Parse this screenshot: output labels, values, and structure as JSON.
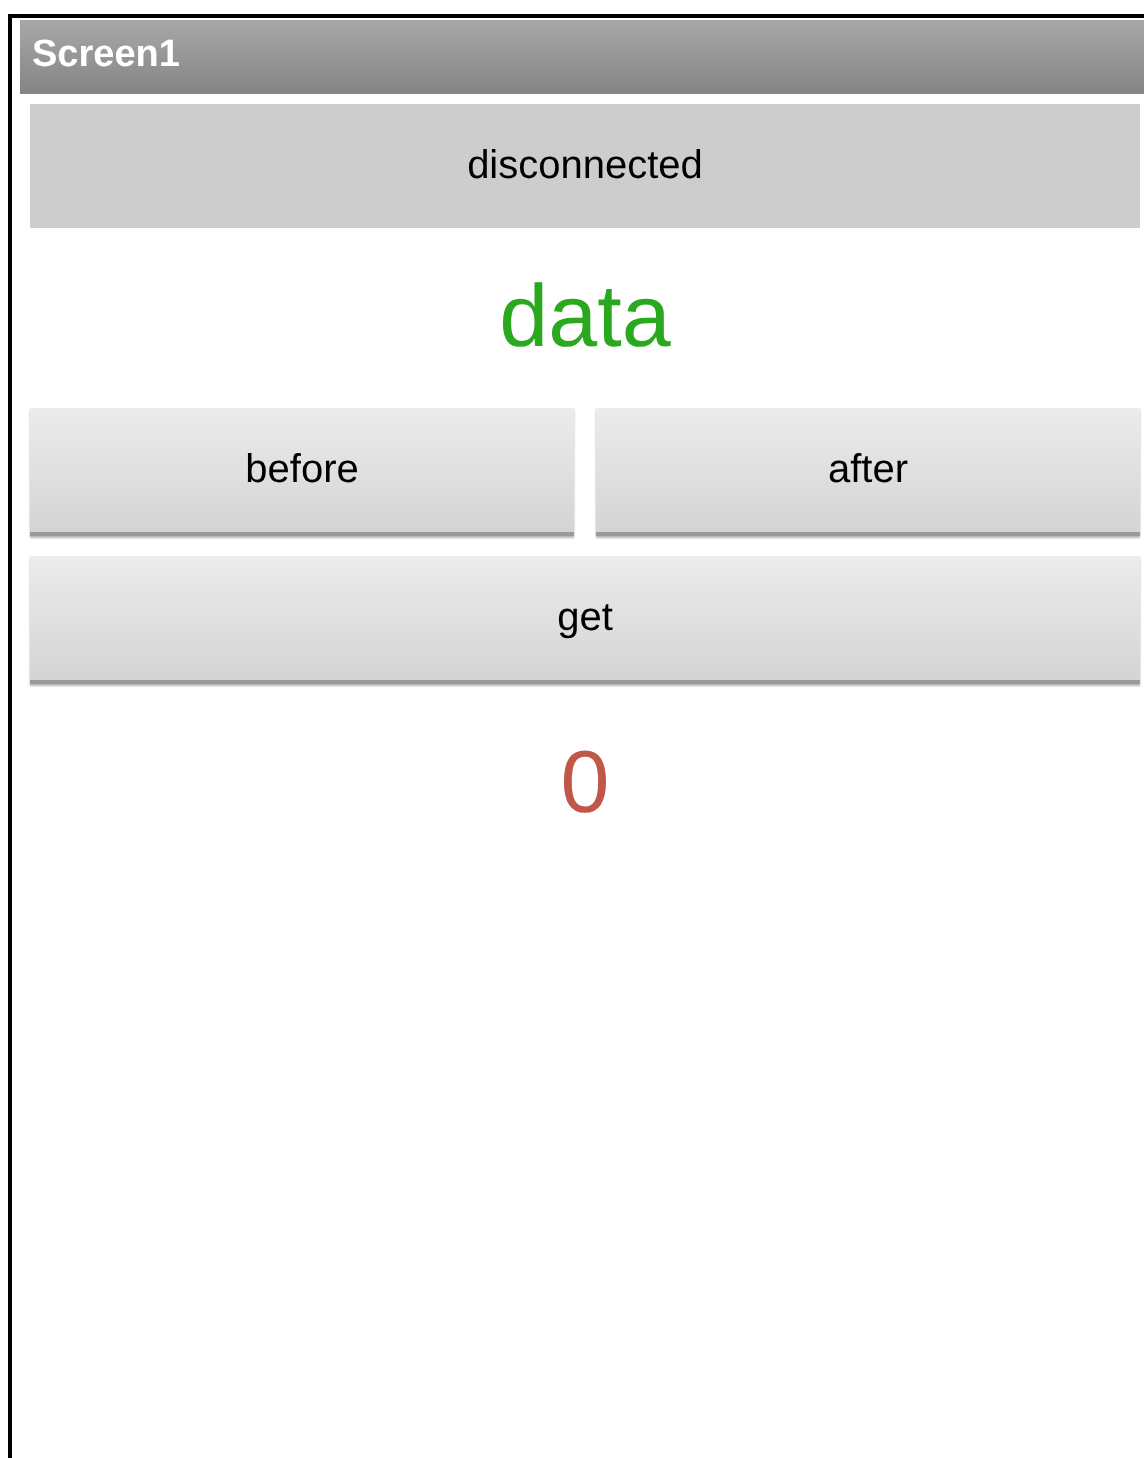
{
  "window": {
    "title": "Screen1"
  },
  "status_button": {
    "label": "disconnected"
  },
  "heading": {
    "text": "data"
  },
  "buttons_row": [
    {
      "label": "before"
    },
    {
      "label": "after"
    }
  ],
  "get_button": {
    "label": "get"
  },
  "value": {
    "text": "0"
  }
}
